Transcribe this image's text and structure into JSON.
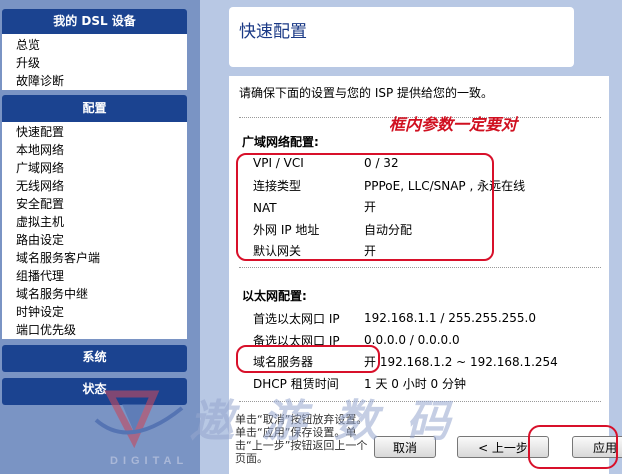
{
  "sidebar": {
    "my_dsl": {
      "title": "我的 DSL 设备",
      "items": [
        "总览",
        "升级",
        "故障诊断"
      ]
    },
    "config": {
      "title": "配置",
      "items": [
        "快速配置",
        "本地网络",
        "广域网络",
        "无线网络",
        "安全配置",
        "虚拟主机",
        "路由设定",
        "域名服务客户端",
        "组播代理",
        "域名服务中继",
        "时钟设定",
        "端口优先级"
      ]
    },
    "system": {
      "title": "系统"
    },
    "status": {
      "title": "状态"
    }
  },
  "watermark": {
    "logo_text": "DIGITAL",
    "site_text": "遨游数码"
  },
  "main": {
    "title": "快速配置",
    "intro": "请确保下面的设置与您的 ISP 提供给您的一致。",
    "annotation": "框内参数一定要对",
    "wan": {
      "title": "广域网络配置:",
      "rows": [
        {
          "label": "VPI / VCI",
          "value": "0 / 32"
        },
        {
          "label": "连接类型",
          "value": "PPPoE,  LLC/SNAP  , 永远在线"
        },
        {
          "label": "NAT",
          "value": "开"
        },
        {
          "label": "外网 IP 地址",
          "value": "自动分配"
        },
        {
          "label": "默认网关",
          "value": "开"
        }
      ]
    },
    "lan": {
      "title": "以太网配置:",
      "rows": [
        {
          "label": "首选以太网口 IP",
          "value": "192.168.1.1 / 255.255.255.0"
        },
        {
          "label": "备选以太网口 IP",
          "value": "0.0.0.0 / 0.0.0.0"
        },
        {
          "label": "域名服务器",
          "value": "开  192.168.1.2 ~ 192.168.1.254"
        },
        {
          "label": "DHCP 租赁时间",
          "value": "1 天 0 小时 0 分钟"
        }
      ]
    },
    "help": "单击“取消”按钮放弃设置。单击“应用”保存设置。单击“上一步”按钮返回上一个页面。",
    "buttons": {
      "cancel": "取消",
      "prev": "< 上一步",
      "apply": "应用"
    }
  },
  "colors": {
    "sidebar_header": "#1b4390",
    "background": "#7a94c4",
    "main_panel": "#b8c8e4",
    "title_text": "#1b3a86",
    "annotation": "#d01020"
  }
}
